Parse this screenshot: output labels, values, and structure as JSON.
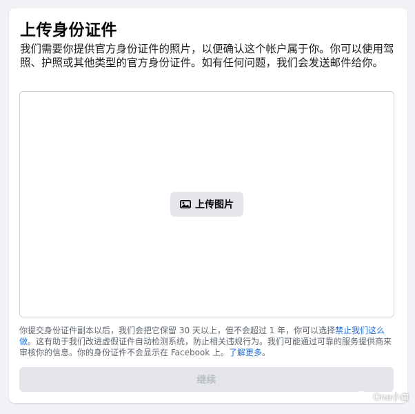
{
  "dialog": {
    "title": "上传身份证件",
    "description": "我们需要你提供官方身份证件的照片，以便确认这个帐户属于你。你可以使用驾照、护照或其他类型的官方身份证件。如有任何问题，我们会发送邮件给你。",
    "upload_button": {
      "label": "上传图片",
      "icon": "image-icon"
    },
    "notice": {
      "text_1": "你提交身份证件副本以后，我们会把它保留 30 天以上，但不会超过 1 年，你可以选择",
      "link_1": "禁止我们这么做",
      "text_2": "。这有助于我们改进虚假证件自动检测系统，防止相关违规行为。我们可能通过可靠的服务提供商来审核你的信息。你的身份证件不会显示在 Facebook 上。",
      "link_2": "了解更多",
      "text_3": "。"
    },
    "continue_button": {
      "label": "继续",
      "disabled": true
    }
  },
  "watermark": {
    "text": "One小白",
    "icon": "wechat-icon"
  },
  "colors": {
    "background": "#f0f2f5",
    "card": "#ffffff",
    "link": "#216fdb",
    "button_gray": "#e4e6eb",
    "disabled_text": "#bcc0c4"
  }
}
